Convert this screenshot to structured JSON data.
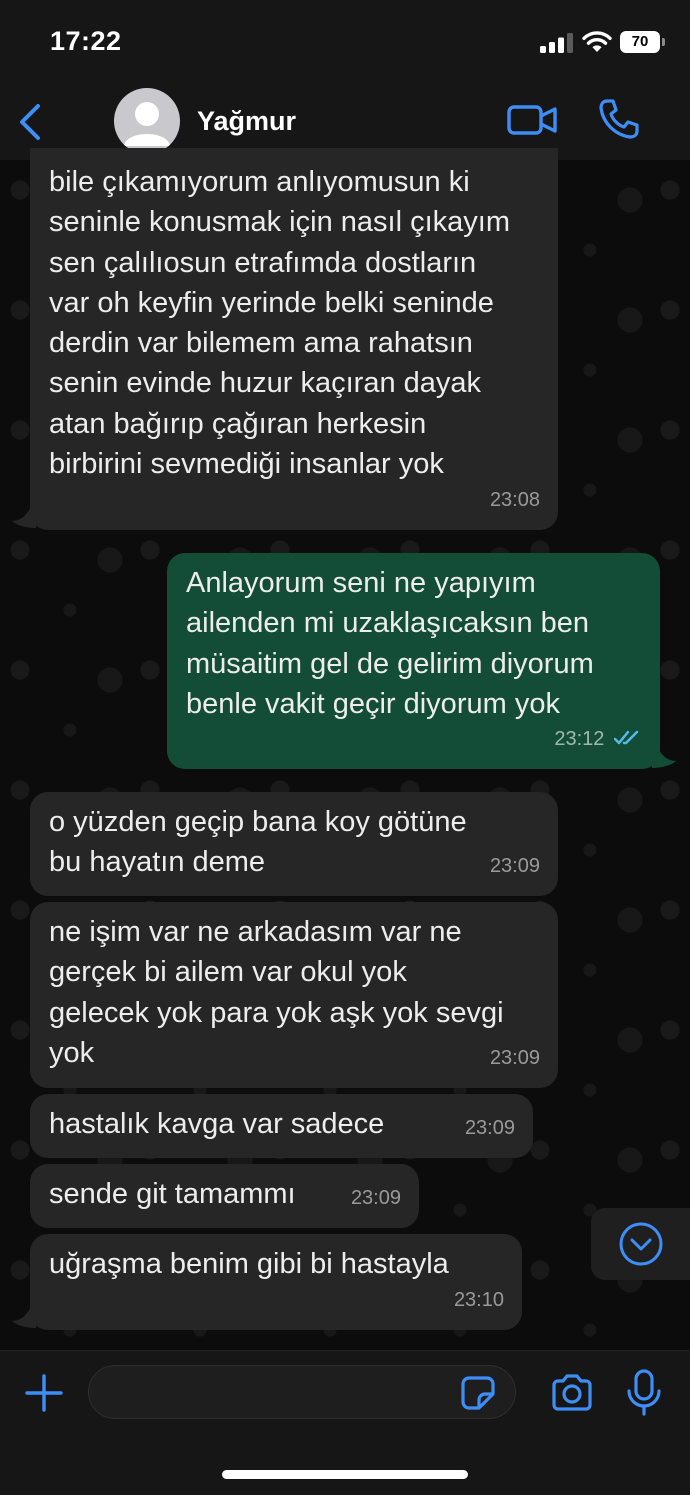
{
  "status_bar": {
    "time": "17:22",
    "battery": "70"
  },
  "header": {
    "contact_name": "Yağmur"
  },
  "messages": [
    {
      "direction": "in",
      "text": "bile çıkamıyorum anlıyomusun ki\nseninle konusmak için nasıl çıkayım\nsen çalılıosun etrafımda dostların\nvar oh keyfin yerinde belki seninde\nderdin var bilemem ama rahatsın\nsenin evinde huzur kaçıran dayak\natan bağırıp çağıran herkesin\nbirbirini sevmediği insanlar yok",
      "time": "23:08"
    },
    {
      "direction": "out",
      "text": "Anlayorum seni ne yapıyım\nailenden mi uzaklaşıcaksın ben\nmüsaitim gel de gelirim diyorum\nbenle vakit geçir diyorum yok",
      "time": "23:12",
      "status": "read"
    },
    {
      "direction": "in",
      "text": "o yüzden geçip bana koy götüne\nbu hayatın deme",
      "time": "23:09"
    },
    {
      "direction": "in",
      "text": "ne işim var ne arkadasım var ne\ngerçek bi ailem var okul yok\ngelecek yok para yok aşk yok sevgi\nyok",
      "time": "23:09"
    },
    {
      "direction": "in",
      "text": "hastalık kavga var sadece",
      "time": "23:09"
    },
    {
      "direction": "in",
      "text": "sende git tamammı",
      "time": "23:09"
    },
    {
      "direction": "in",
      "text": "uğraşma benim gibi bi hastayla",
      "time": "23:10"
    }
  ],
  "input": {
    "placeholder": ""
  },
  "colors": {
    "accent": "#3e8ef7",
    "incoming_bubble": "#262626",
    "outgoing_bubble": "#144d37",
    "read_ticks": "#53bdeb"
  }
}
